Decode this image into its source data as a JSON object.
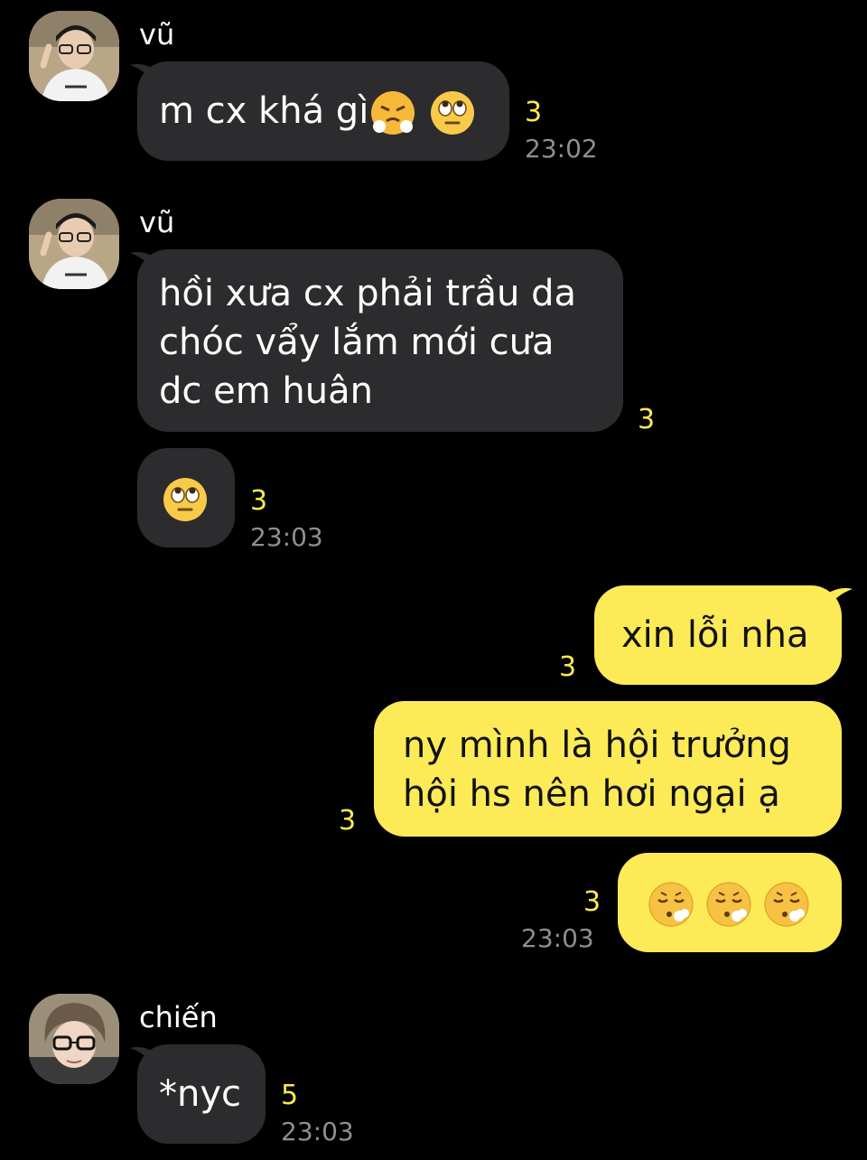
{
  "messages": [
    {
      "sender": "vũ",
      "lines": [
        "m cx khá gì"
      ],
      "unread": "3",
      "time": "23:02"
    },
    {
      "sender": "vũ",
      "lines": [
        "hồi xưa cx phải trầu da",
        "chóc vẩy lắm mới cưa",
        "dc em huân"
      ],
      "unread": "3"
    },
    {
      "unread": "3",
      "time": "23:03"
    },
    {
      "lines": [
        "xin lỗi nha"
      ],
      "unread": "3"
    },
    {
      "lines": [
        "ny mình là hội trưởng",
        "hội hs nên hơi ngại ạ"
      ],
      "unread": "3"
    },
    {
      "unread": "3",
      "time": "23:03"
    },
    {
      "sender": "chiến",
      "lines": [
        "*nyc"
      ],
      "unread": "5",
      "time": "23:03"
    }
  ],
  "emoji_names": [
    "face-with-steam-icon",
    "rolling-eyes-icon",
    "exhaling-face-icon"
  ],
  "colors": {
    "background": "#000000",
    "incoming_bubble": "#2c2c2e",
    "outgoing_bubble": "#fcea57",
    "unread": "#fce94f",
    "time": "#8e8e93"
  }
}
